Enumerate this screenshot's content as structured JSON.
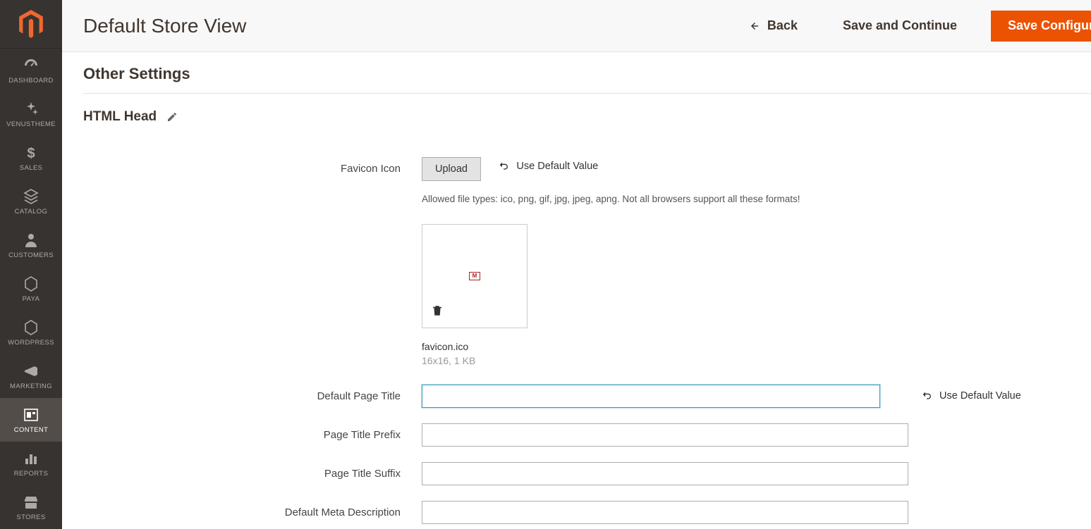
{
  "sidebar": {
    "items": [
      {
        "label": "DASHBOARD"
      },
      {
        "label": "VENUSTHEME"
      },
      {
        "label": "SALES"
      },
      {
        "label": "CATALOG"
      },
      {
        "label": "CUSTOMERS"
      },
      {
        "label": "PAYA"
      },
      {
        "label": "WORDPRESS"
      },
      {
        "label": "MARKETING"
      },
      {
        "label": "CONTENT"
      },
      {
        "label": "REPORTS"
      },
      {
        "label": "STORES"
      }
    ]
  },
  "toolbar": {
    "title": "Default Store View",
    "back_label": "Back",
    "save_continue_label": "Save and Continue",
    "save_config_label": "Save Configuration"
  },
  "page": {
    "section_title": "Other Settings",
    "fieldset_title": "HTML Head",
    "use_default_label": "Use Default Value"
  },
  "html_head": {
    "favicon": {
      "label": "Favicon Icon",
      "upload_label": "Upload",
      "hint": "Allowed file types: ico, png, gif, jpg, jpeg, apng. Not all browsers support all these formats!",
      "file_name": "favicon.ico",
      "file_meta": "16x16, 1 KB"
    },
    "default_page_title": {
      "label": "Default Page Title",
      "value": ""
    },
    "page_title_prefix": {
      "label": "Page Title Prefix",
      "value": ""
    },
    "page_title_suffix": {
      "label": "Page Title Suffix",
      "value": ""
    },
    "default_meta_description": {
      "label": "Default Meta Description",
      "value": ""
    }
  }
}
